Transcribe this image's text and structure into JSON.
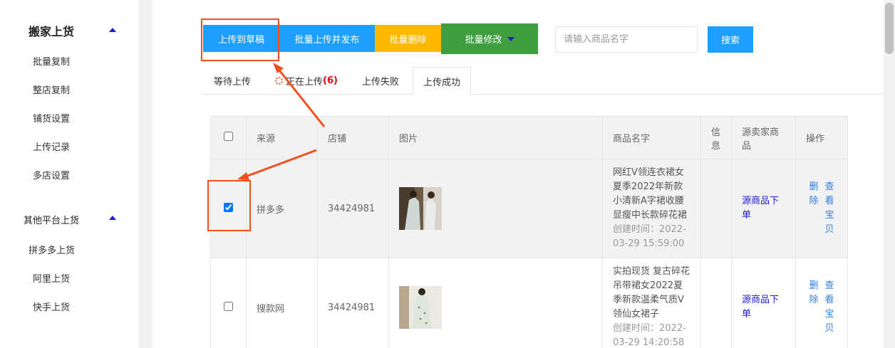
{
  "sidebar": {
    "group1": {
      "title": "搬家上货",
      "items": [
        "批量复制",
        "整店复制",
        "铺货设置",
        "上传记录",
        "多店设置"
      ]
    },
    "group2": {
      "title": "其他平台上货",
      "items": [
        "拼多多上货",
        "阿里上货",
        "快手上货"
      ]
    }
  },
  "toolbar": {
    "upload_draft": "上传到草稿",
    "upload_publish": "批量上传并发布",
    "batch_delete": "批量删除",
    "batch_edit": "批量修改",
    "search_placeholder": "请输入商品名字",
    "search_button": "搜索"
  },
  "tabs": {
    "waiting": "等待上传",
    "uploading": "正在上传",
    "uploading_count": "(6)",
    "failed": "上传失败",
    "success": "上传成功"
  },
  "table": {
    "headers": {
      "source": "来源",
      "shop": "店铺",
      "image": "图片",
      "name": "商品名字",
      "info": "信息",
      "seller": "源卖家商品",
      "ops": "操作"
    },
    "rows": [
      {
        "checked": true,
        "source": "拼多多",
        "shop": "34424981",
        "name": "网红V领连衣裙女夏季2022年新款小清新A字裙收腰显瘦中长款碎花裙",
        "created": "创建时间：2022-03-29 15:59:00",
        "seller_link": "源商品下单",
        "op_delete": "删除",
        "op_view": "查看宝贝"
      },
      {
        "checked": false,
        "source": "搜款网",
        "shop": "34424981",
        "name": "实拍现货 复古碎花吊带裙女2022夏季新款温柔气质V领仙女裙子",
        "created": "创建时间：2022-03-29 14:20:58",
        "seller_link": "源商品下单",
        "op_delete": "删除",
        "op_view": "查看宝贝"
      }
    ]
  },
  "colors": {
    "blue": "#1e9fff",
    "yellow": "#ffb800",
    "green": "#3e9e40",
    "annotation": "#f24f1c"
  }
}
